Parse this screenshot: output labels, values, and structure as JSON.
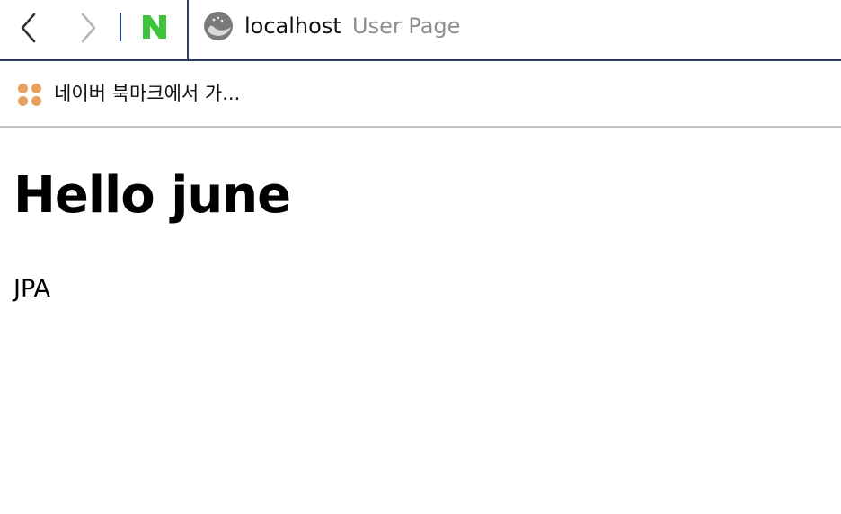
{
  "browser": {
    "url_host": "localhost",
    "page_title": "User Page",
    "bookmark_label": "네이버 북마크에서 가...",
    "icons": {
      "back": "chevron-left-icon",
      "forward": "chevron-right-icon",
      "naver": "naver-logo-icon",
      "site": "whale-site-icon",
      "bookmarks": "bookmark-dots-icon"
    },
    "colors": {
      "naver_green": "#3ec43b",
      "bookmark_orange": "#e8a060",
      "separator_blue": "#1f3f8f"
    }
  },
  "page": {
    "heading": "Hello june",
    "paragraph": "JPA"
  }
}
